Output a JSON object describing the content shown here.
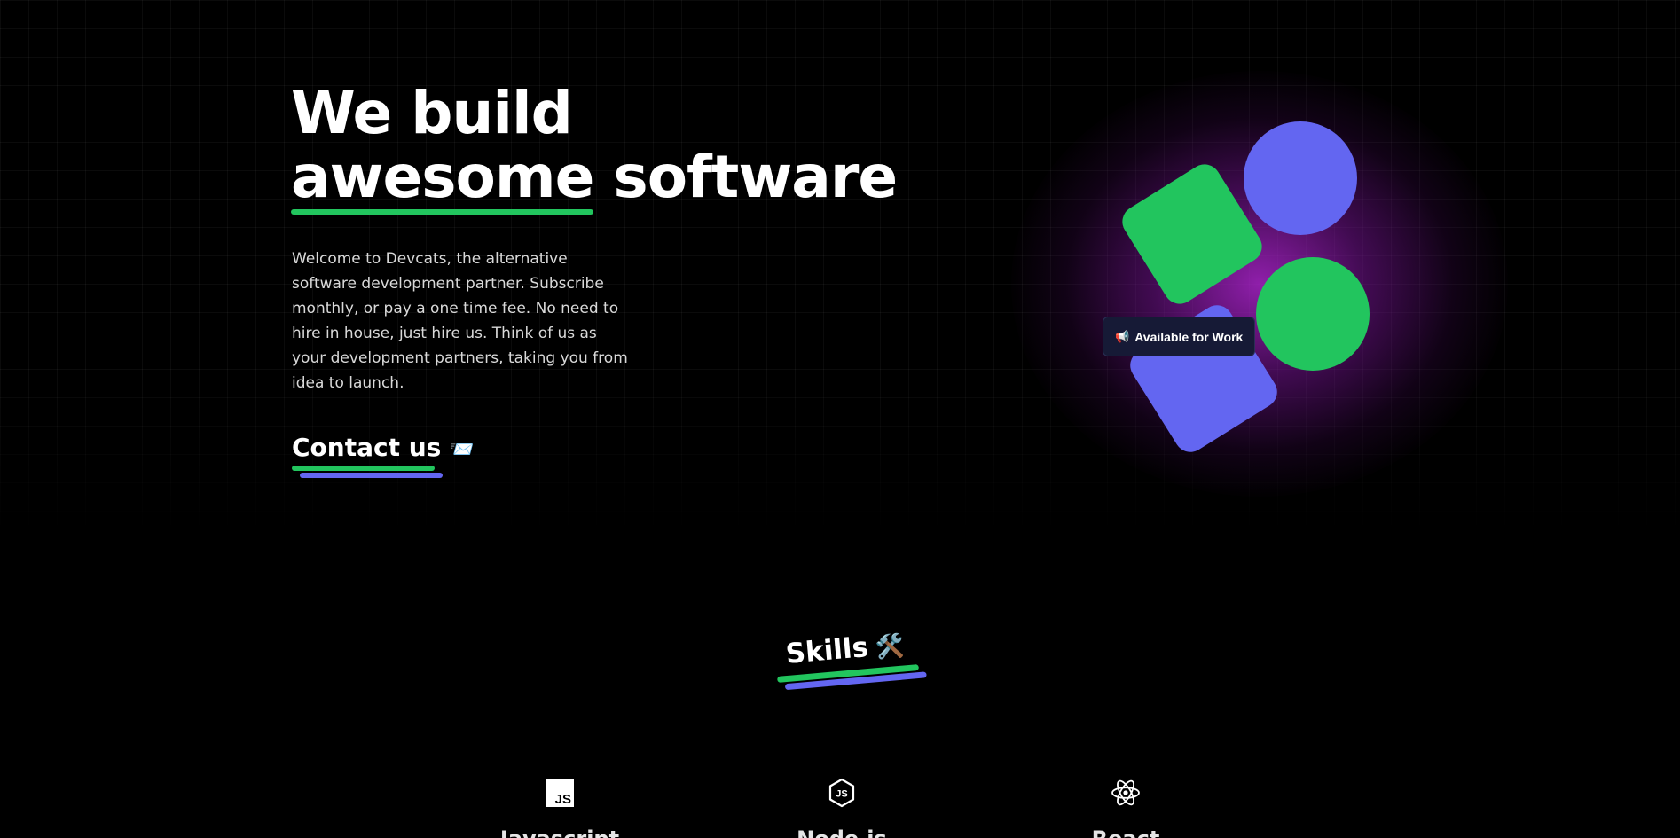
{
  "hero": {
    "title_line1": "We build",
    "title_highlight": "awesome",
    "title_rest": "software",
    "description": "Welcome to Devcats, the alternative software development partner. Subscribe monthly, or pay a one time fee. No need to hire in house, just hire us. Think of us as your development partners, taking you from idea to launch.",
    "contact_label": "Contact us",
    "contact_icon": "📨"
  },
  "badge": {
    "icon": "📢",
    "label": "Available for Work"
  },
  "skills": {
    "title": "Skills",
    "title_icon": "🛠️",
    "items": [
      {
        "name": "Javascript",
        "icon": "javascript-icon",
        "icon_text": "JS"
      },
      {
        "name": "Node.js",
        "icon": "nodejs-icon"
      },
      {
        "name": "React",
        "icon": "react-icon"
      }
    ]
  },
  "colors": {
    "accent_green": "#22c55e",
    "accent_blue": "#6366f1",
    "glow_purple": "#a824c8",
    "background": "#000000"
  }
}
